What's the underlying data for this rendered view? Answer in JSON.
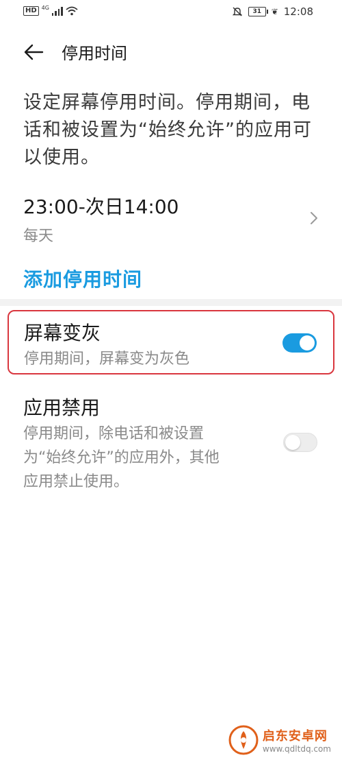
{
  "status_bar": {
    "hd": "HD",
    "network": "4G",
    "battery": "31",
    "time": "12:08"
  },
  "header": {
    "title": "停用时间"
  },
  "description": "设定屏幕停用时间。停用期间，电话和被设置为“始终允许”的应用可以使用。",
  "schedule": {
    "time": "23:00-次日14:00",
    "repeat": "每天"
  },
  "add_link": "添加停用时间",
  "screen_grey": {
    "title": "屏幕变灰",
    "subtitle": "停用期间，屏幕变为灰色",
    "enabled": true
  },
  "app_disable": {
    "title": "应用禁用",
    "subtitle_lines": [
      "停用期间，除电话和被设置",
      "为“始终允许”的应用外，其他",
      "应用禁止使用。"
    ],
    "enabled": false
  },
  "watermark": {
    "name": "启东安卓网",
    "url": "www.qdltdq.com"
  },
  "colors": {
    "accent": "#1a9be0",
    "highlight_border": "#d9363e"
  }
}
